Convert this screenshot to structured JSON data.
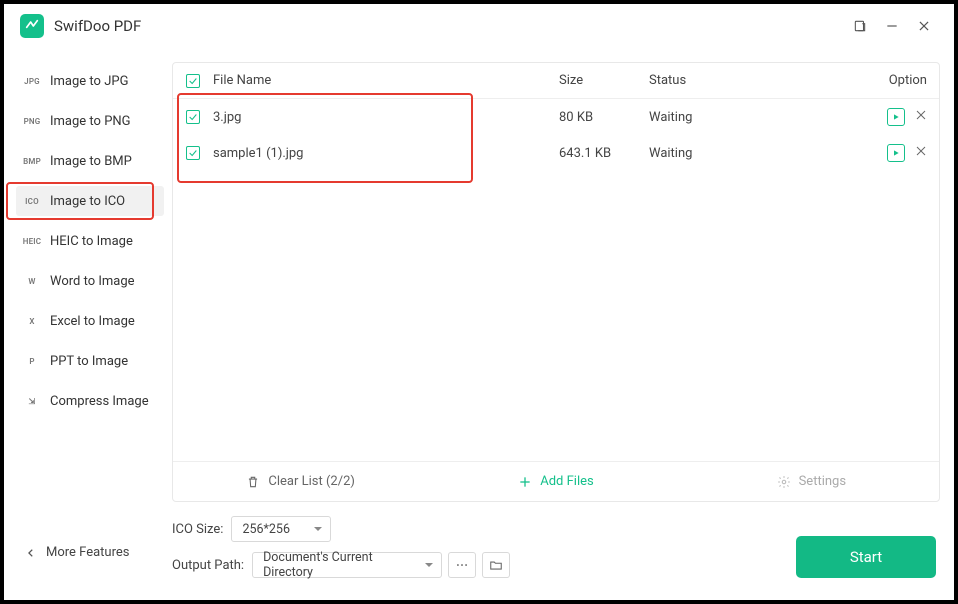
{
  "app_title": "SwifDoo PDF",
  "sidebar": {
    "items": [
      {
        "badge": "JPG",
        "label": "Image to JPG"
      },
      {
        "badge": "PNG",
        "label": "Image to PNG"
      },
      {
        "badge": "BMP",
        "label": "Image to BMP"
      },
      {
        "badge": "ICO",
        "label": "Image to ICO"
      },
      {
        "badge": "HEIC",
        "label": "HEIC to Image"
      },
      {
        "badge": "W",
        "label": "Word to Image"
      },
      {
        "badge": "X",
        "label": "Excel to Image"
      },
      {
        "badge": "P",
        "label": "PPT to Image"
      },
      {
        "badge": "⇲",
        "label": "Compress Image"
      }
    ],
    "selected_index": 3,
    "more_label": "More Features"
  },
  "table": {
    "headers": {
      "name": "File Name",
      "size": "Size",
      "status": "Status",
      "option": "Option"
    },
    "rows": [
      {
        "checked": true,
        "name": "3.jpg",
        "size": "80 KB",
        "status": "Waiting"
      },
      {
        "checked": true,
        "name": "sample1 (1).jpg",
        "size": "643.1 KB",
        "status": "Waiting"
      }
    ]
  },
  "actions": {
    "clear": "Clear List (2/2)",
    "add": "Add Files",
    "settings": "Settings"
  },
  "footer": {
    "size_label": "ICO Size:",
    "size_value": "256*256",
    "path_label": "Output Path:",
    "path_value": "Document's Current Directory",
    "start_label": "Start"
  }
}
